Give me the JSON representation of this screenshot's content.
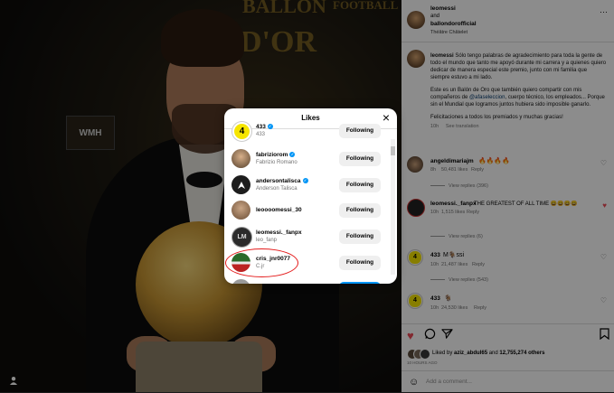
{
  "photo": {
    "bg_text_1": "BALLON",
    "bg_text_2": "D'OR",
    "bg_text_3": "FOOTBALL",
    "sponsor_badge": "WMH"
  },
  "post": {
    "author": "leomessi",
    "collab_connector": "and",
    "collab_author": "ballondorofficial",
    "location": "Théâtre Châtelet",
    "more_icon": "more-horizontal-icon",
    "caption_p1": "Sólo tengo palabras de agradecimiento para toda la gente de todo el mundo que tanto me apoyó durante mi carrera y a quienes quiero dedicar de manera especial este premio, junto con mi familia que siempre estuvo a mi lado.",
    "caption_p2_a": "Este es un Balón de Oro que también quiero compartir con mis compañeros de ",
    "caption_mention": "@afaseleccion",
    "caption_p2_b": ", cuerpo técnico, los empleados... Porque sin el Mundial que logramos juntos hubiera sido imposible ganarlo.",
    "caption_p3": "Felicitaciones a todos los premiados y muchas gracias!",
    "caption_time": "10h",
    "see_translation": "See translation",
    "likes_prefix": "Liked by",
    "likes_user": "aziz_abdul65",
    "likes_and": "and",
    "likes_count": "12,755,274 others",
    "posted_ago": "10 HOURS AGO",
    "add_comment_placeholder": "Add a comment..."
  },
  "comments": [
    {
      "user": "angeldimariajm",
      "text": "🔥🔥🔥🔥",
      "time": "8h",
      "likes": "50,481 likes",
      "reply": "Reply",
      "view_replies": "View replies (396)"
    },
    {
      "user": "leomessi._fanpx",
      "text": "THE GREATEST OF ALL TIME 😄😄😄😄",
      "time": "10h",
      "likes": "1,515 likes",
      "reply": "Reply",
      "view_replies": "View replies (6)",
      "liked": true
    },
    {
      "user": "433",
      "text": "M🐐ssi",
      "time": "10h",
      "likes": "21,487 likes",
      "reply": "Reply",
      "view_replies": "View replies (543)"
    },
    {
      "user": "433",
      "text": "🐐",
      "time": "10h",
      "likes": "24,530 likes",
      "reply": "Reply",
      "view_replies": ""
    }
  ],
  "likes_modal": {
    "title": "Likes",
    "close_label": "×",
    "rows": [
      {
        "username": "433",
        "fullname": "433",
        "verified": true,
        "button": "Following"
      },
      {
        "username": "fabriziorom",
        "fullname": "Fabrizio Romano",
        "verified": true,
        "button": "Following"
      },
      {
        "username": "andersontalisca",
        "fullname": "Anderson Talisca",
        "verified": true,
        "button": "Following"
      },
      {
        "username": "leoooomessi_30",
        "fullname": "",
        "verified": false,
        "button": "Following"
      },
      {
        "username": "leomessi._fanpx",
        "fullname": "leo_fanp",
        "verified": false,
        "button": "Following"
      },
      {
        "username": "cris_jnr0077",
        "fullname": "C.jr",
        "verified": false,
        "button": "Following"
      }
    ]
  },
  "colors": {
    "accent_blue": "#0095f6",
    "like_red": "#ed4956",
    "annotation_red": "#e41b1b",
    "badge_yellow": "#f6e500"
  }
}
